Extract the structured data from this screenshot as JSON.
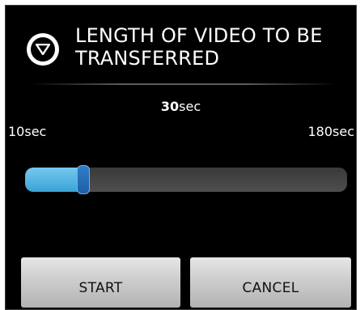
{
  "dialog": {
    "icon": "chevron-down-circle-icon",
    "title_line1": "LENGTH OF VIDEO TO BE",
    "title_line2": "TRANSFERRED"
  },
  "slider": {
    "current_value": "30",
    "current_unit": "sec",
    "min_label": "10sec",
    "max_label": "180sec",
    "min": 10,
    "max": 180,
    "value": 30,
    "fill_color": "#4fb4e6",
    "thumb_color": "#2a72c0"
  },
  "buttons": {
    "start_label": "START",
    "cancel_label": "CANCEL"
  }
}
